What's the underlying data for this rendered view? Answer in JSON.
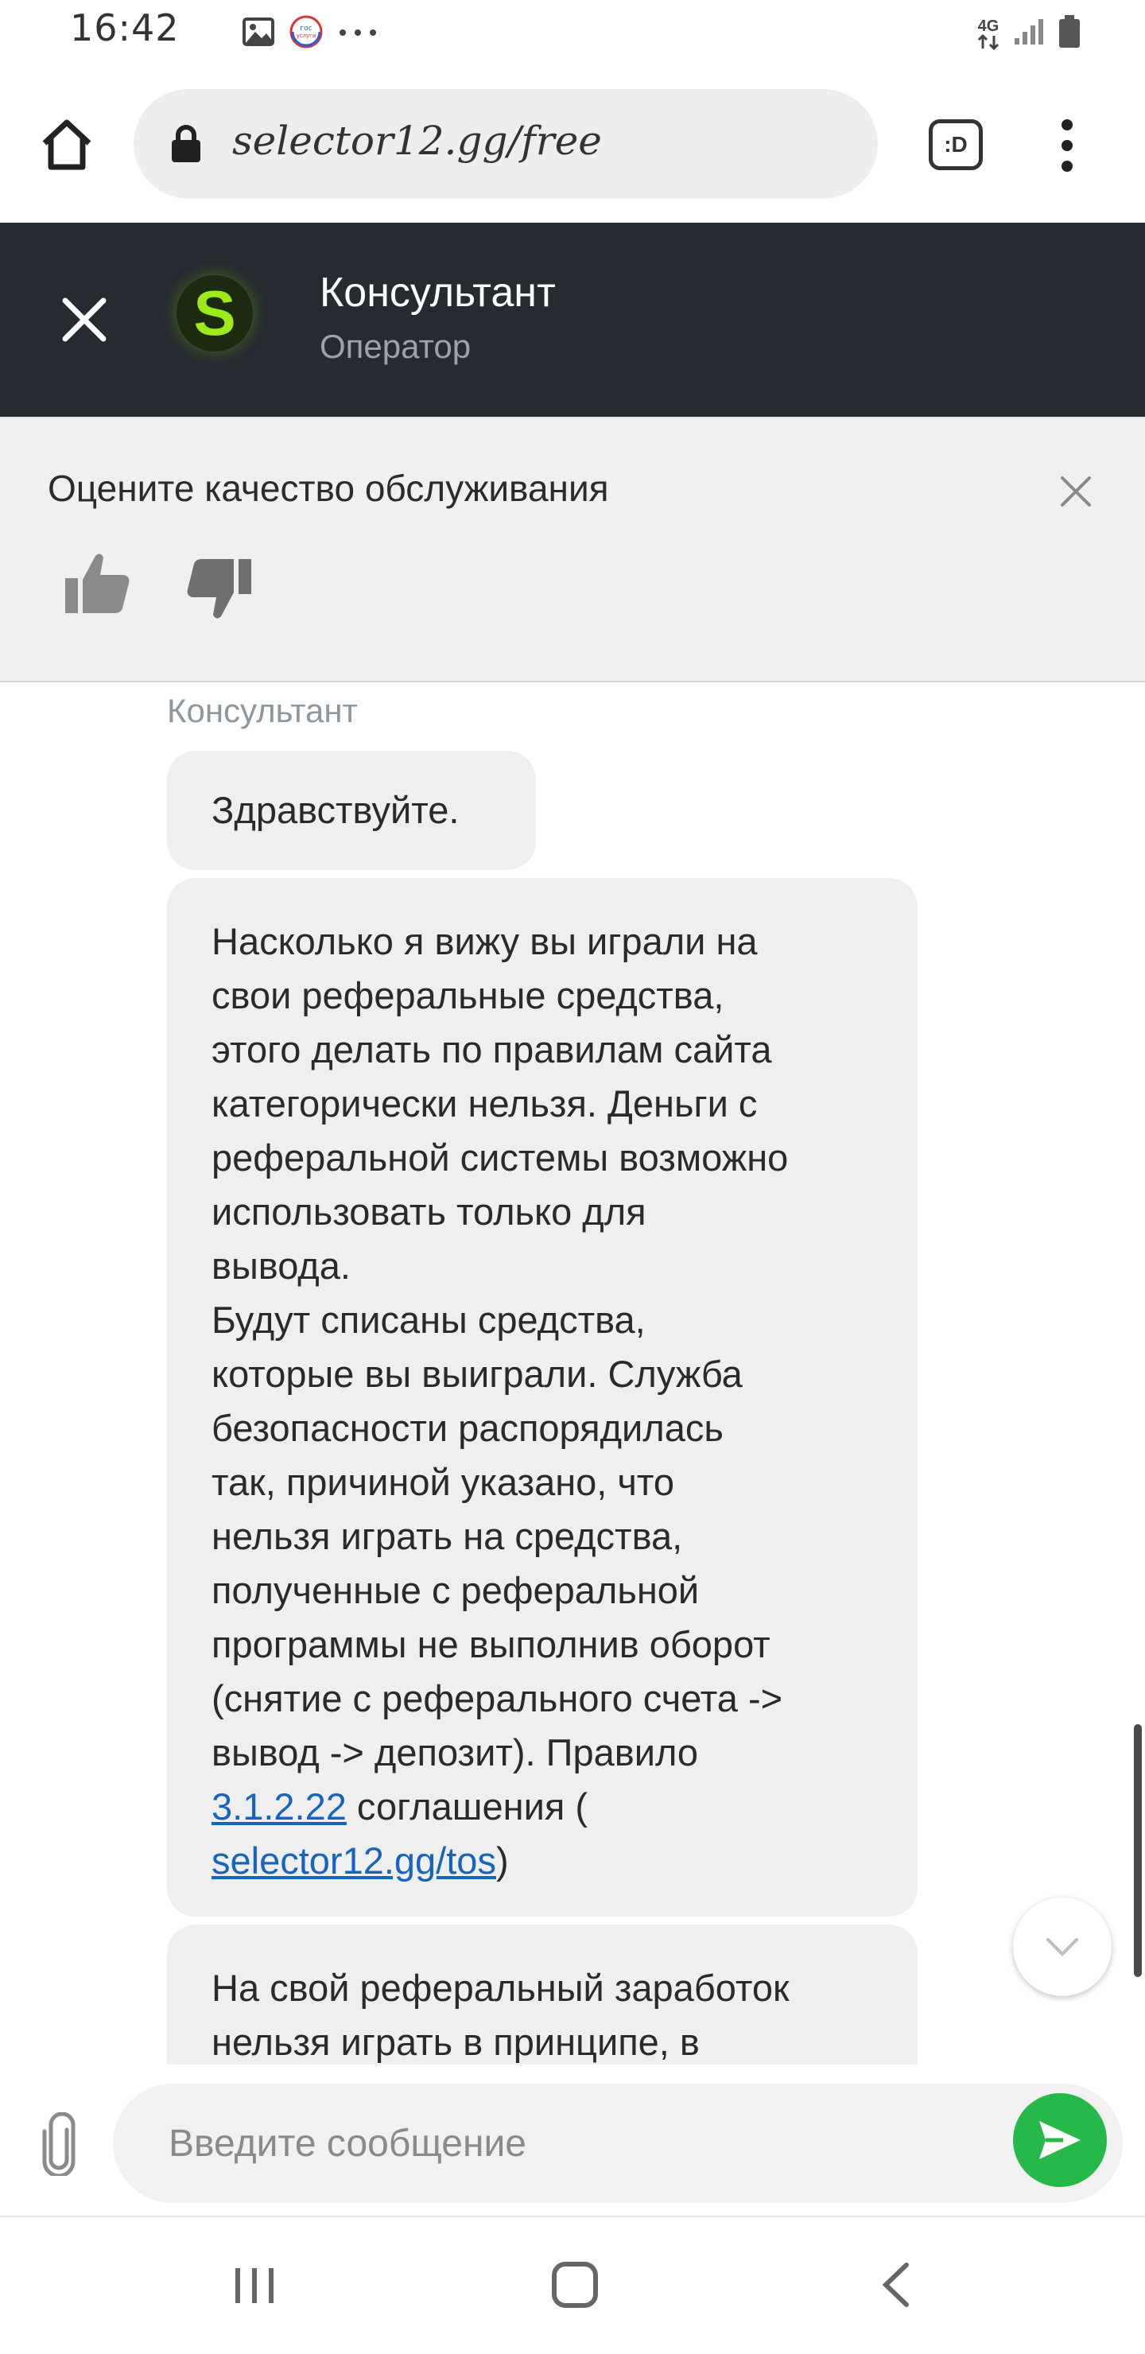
{
  "status_bar": {
    "time": "16:42",
    "left_icons": [
      "image-icon",
      "gosuslugi-icon",
      "more-dots-icon"
    ],
    "network_label": "4G",
    "right_icons": [
      "signal-icon",
      "battery-icon"
    ]
  },
  "browser": {
    "url": "selector12.gg/free",
    "tab_button_label": ":D"
  },
  "chat_header": {
    "avatar_letter": "S",
    "agent_name": "Консультант",
    "agent_role": "Оператор"
  },
  "rating": {
    "title": "Оцените качество обслуживания"
  },
  "chat": {
    "sender_label": "Консультант",
    "messages": [
      {
        "text": "Здравствуйте."
      },
      {
        "text_before_link": "Насколько я вижу вы играли на\nсвои реферальные средства,\nэтого делать по правилам сайта\nкатегорически нельзя. Деньги с\nреферальной системы возможно\nиспользовать только для\nвывода.\nБудут списаны средства,\nкоторые вы выиграли. Служба\nбезопасности распорядилась\nтак, причиной указано, что\nнельзя играть на средства,\nполученные с реферальной\nпрограммы не выполнив оборот\n(снятие с реферального счета ->\nвывод -> депозит). Правило\n",
        "link_1": "3.1.2.22",
        "text_middle": " соглашения (\n",
        "link_2": "selector12.gg/tos",
        "text_after_link": ")"
      },
      {
        "text": "На свой реферальный заработок\nнельзя играть в принципе, в"
      }
    ]
  },
  "composer": {
    "placeholder": "Введите сообщение"
  },
  "colors": {
    "header_bg": "#262a31",
    "avatar_green": "#9cea1a",
    "send_green": "#27b84a",
    "link_blue": "#1565c0",
    "bubble_bg": "#efefef"
  }
}
